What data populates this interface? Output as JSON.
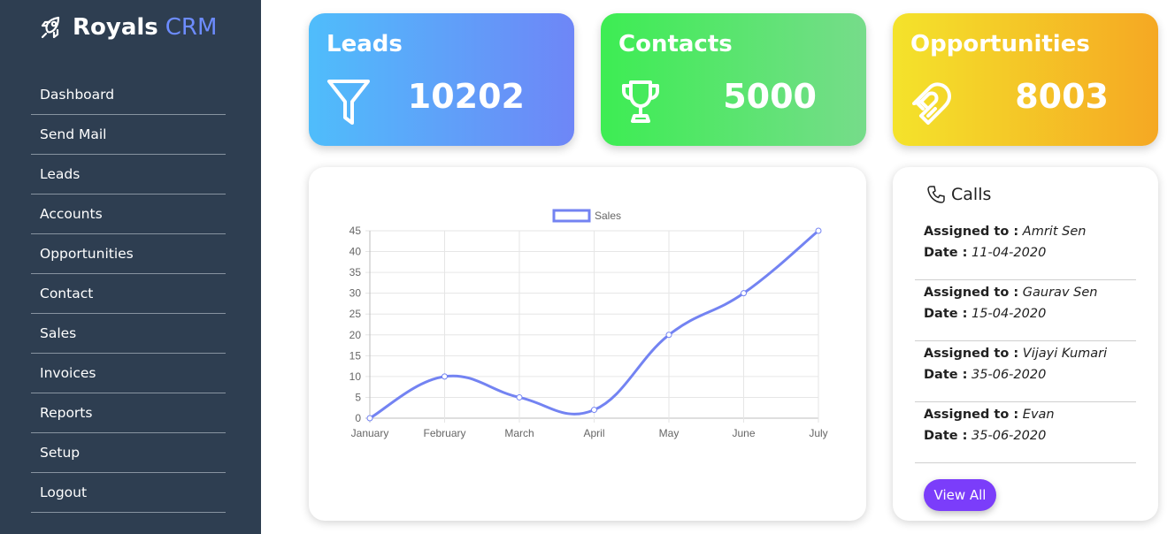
{
  "brand": {
    "name": "Royals",
    "accent": "CRM"
  },
  "nav": [
    {
      "label": "Dashboard"
    },
    {
      "label": "Send Mail"
    },
    {
      "label": "Leads"
    },
    {
      "label": "Accounts"
    },
    {
      "label": "Opportunities"
    },
    {
      "label": "Contact"
    },
    {
      "label": "Sales"
    },
    {
      "label": "Invoices"
    },
    {
      "label": "Reports"
    },
    {
      "label": "Setup"
    },
    {
      "label": "Logout"
    }
  ],
  "cards": [
    {
      "title": "Leads",
      "value": "10202",
      "icon": "funnel-icon"
    },
    {
      "title": "Contacts",
      "value": "5000",
      "icon": "trophy-icon"
    },
    {
      "title": "Opportunities",
      "value": "8003",
      "icon": "magnet-icon"
    }
  ],
  "calls": {
    "title": "Calls",
    "assigned_label": "Assigned to :",
    "date_label": "Date :",
    "items": [
      {
        "assignee": "Amrit Sen",
        "date": "11-04-2020"
      },
      {
        "assignee": "Gaurav Sen",
        "date": "15-04-2020"
      },
      {
        "assignee": "Vijayi Kumari",
        "date": "35-06-2020"
      },
      {
        "assignee": "Evan",
        "date": "35-06-2020"
      }
    ],
    "view_all_label": "View All"
  },
  "colors": {
    "sidebar": "#2e3e51",
    "brand_accent": "#6d8cff",
    "line": "#7383f2",
    "button": "#7b3dfa"
  },
  "chart_data": {
    "type": "line",
    "categories": [
      "January",
      "February",
      "March",
      "April",
      "May",
      "June",
      "July"
    ],
    "series": [
      {
        "name": "Sales",
        "values": [
          0,
          10,
          5,
          2,
          20,
          30,
          45
        ]
      }
    ],
    "ylim": [
      0,
      45
    ],
    "yticks": [
      0,
      5,
      10,
      15,
      20,
      25,
      30,
      35,
      40,
      45
    ],
    "grid": true,
    "legend": "top-center",
    "title": "",
    "xlabel": "",
    "ylabel": ""
  }
}
